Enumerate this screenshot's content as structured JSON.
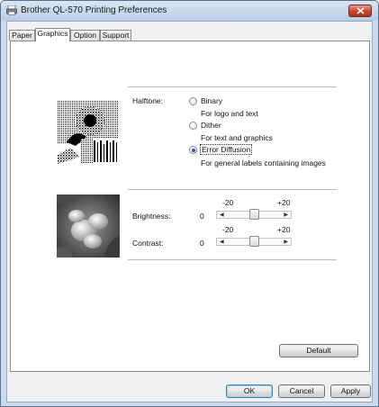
{
  "window": {
    "title": "Brother QL-570 Printing Preferences",
    "close_icon": "close-icon"
  },
  "tabs": [
    {
      "label": "Paper",
      "active": false
    },
    {
      "label": "Graphics",
      "active": true
    },
    {
      "label": "Option",
      "active": false
    },
    {
      "label": "Support",
      "active": false
    }
  ],
  "halftone": {
    "label": "Halftone:",
    "options": [
      {
        "label": "Binary",
        "description": "For logo and text",
        "selected": false
      },
      {
        "label": "Dither",
        "description": "For text and graphics",
        "selected": false
      },
      {
        "label": "Error Diffusion",
        "description": "For general labels containing images",
        "selected": true
      }
    ]
  },
  "brightness": {
    "label": "Brightness:",
    "value": "0",
    "min_label": "-20",
    "max_label": "+20"
  },
  "contrast": {
    "label": "Contrast:",
    "value": "0",
    "min_label": "-20",
    "max_label": "+20"
  },
  "buttons": {
    "default": "Default",
    "ok": "OK",
    "cancel": "Cancel",
    "apply": "Apply"
  }
}
